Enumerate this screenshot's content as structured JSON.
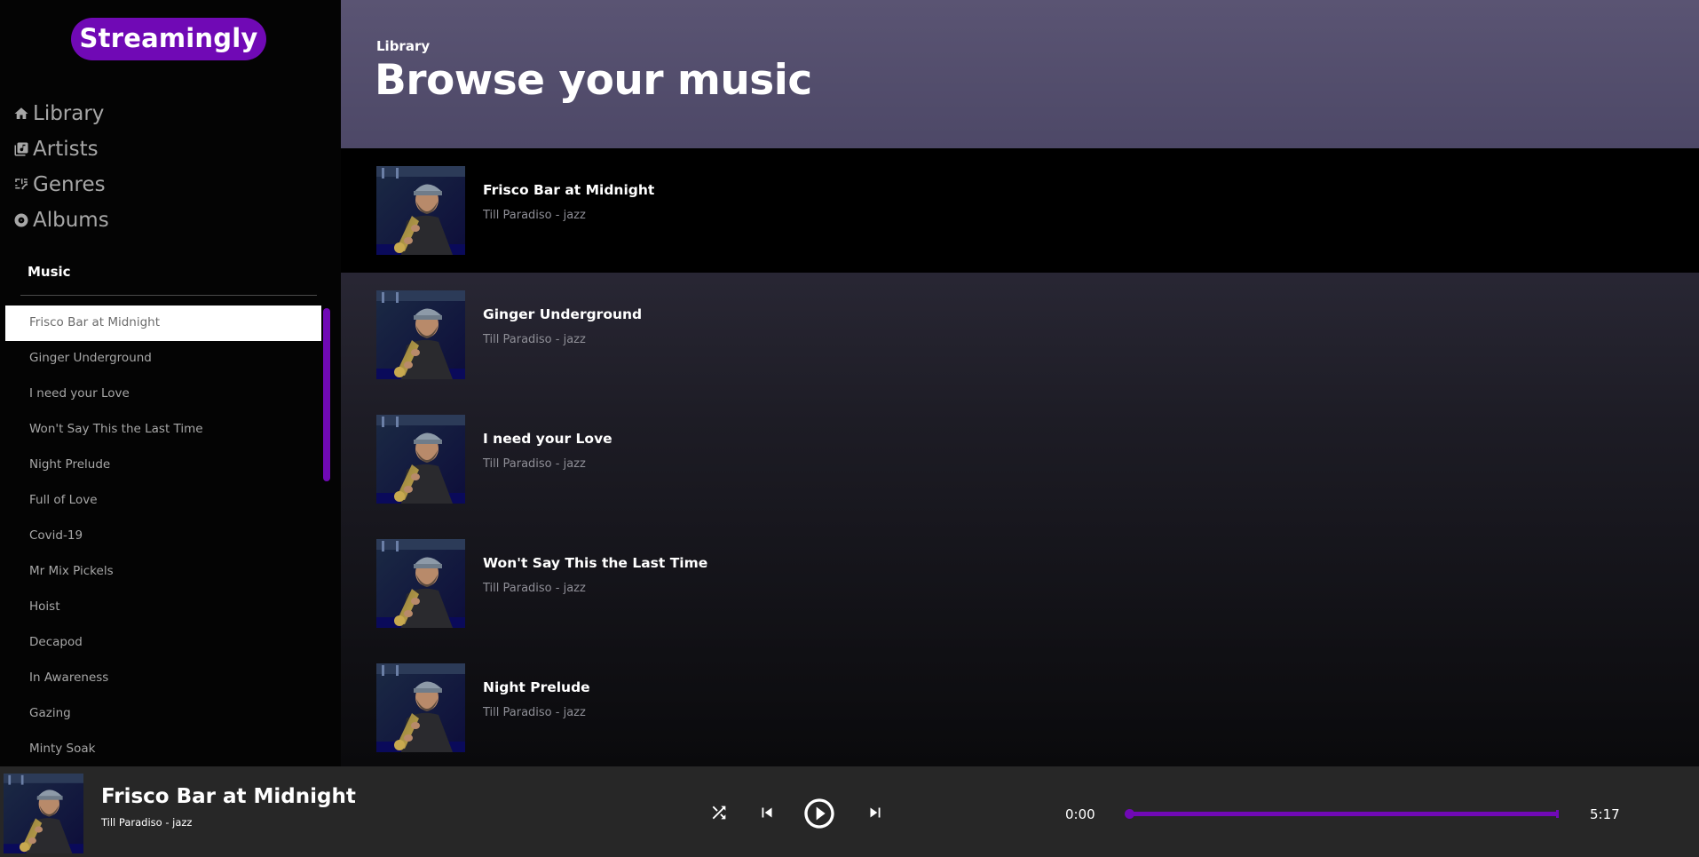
{
  "app": {
    "logo": "Streamingly",
    "accent_color": "#7009b5"
  },
  "nav": {
    "items": [
      {
        "label": "Library",
        "icon": "home-icon"
      },
      {
        "label": "Artists",
        "icon": "library-music-icon"
      },
      {
        "label": "Genres",
        "icon": "genres-icon"
      },
      {
        "label": "Albums",
        "icon": "album-icon"
      }
    ]
  },
  "sidebar": {
    "section_title": "Music",
    "tracks": [
      {
        "label": "Frisco Bar at Midnight",
        "active": true
      },
      {
        "label": "Ginger Underground"
      },
      {
        "label": "I need your Love"
      },
      {
        "label": "Won't Say This the Last Time"
      },
      {
        "label": "Night Prelude"
      },
      {
        "label": "Full of Love"
      },
      {
        "label": "Covid-19"
      },
      {
        "label": "Mr Mix Pickels"
      },
      {
        "label": "Hoist"
      },
      {
        "label": "Decapod"
      },
      {
        "label": "In Awareness"
      },
      {
        "label": "Gazing"
      },
      {
        "label": "Minty Soak"
      }
    ]
  },
  "main": {
    "breadcrumb": "Library",
    "title": "Browse your music",
    "songs": [
      {
        "title": "Frisco Bar at Midnight",
        "subtitle": "Till Paradiso - jazz"
      },
      {
        "title": "Ginger Underground",
        "subtitle": "Till Paradiso - jazz"
      },
      {
        "title": "I need your Love",
        "subtitle": "Till Paradiso - jazz"
      },
      {
        "title": "Won't Say This the Last Time",
        "subtitle": "Till Paradiso - jazz"
      },
      {
        "title": "Night Prelude",
        "subtitle": "Till Paradiso - jazz"
      }
    ]
  },
  "player": {
    "title": "Frisco Bar at Midnight",
    "subtitle": "Till Paradiso - jazz",
    "current_time": "0:00",
    "total_time": "5:17",
    "progress": 0
  }
}
